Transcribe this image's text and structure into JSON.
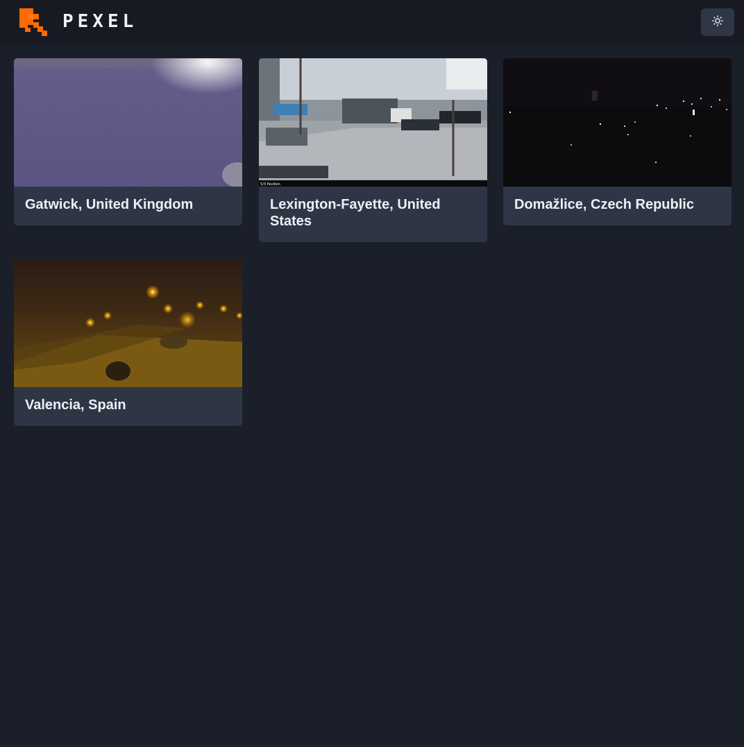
{
  "app": {
    "name": "PEXEL",
    "colors": {
      "background": "#1b1f2a",
      "header": "#171a22",
      "card": "#2e3646",
      "accent": "#ff6a00"
    }
  },
  "header": {
    "logo_icon": "pexel-logo-icon",
    "theme_toggle_icon": "sun-icon"
  },
  "cameras": [
    {
      "location": "Gatwick, United Kingdom",
      "thumbnail": "purple-noisy-night-field"
    },
    {
      "location": "Lexington-Fayette, United States",
      "thumbnail": "daytime-street-trucks",
      "overlay_caption": "5/3 Pavilion"
    },
    {
      "location": "Domažlice, Czech Republic",
      "thumbnail": "dark-night-town-lights"
    },
    {
      "location": "Valencia, Spain",
      "thumbnail": "orange-streetlight-night-plaza"
    }
  ]
}
